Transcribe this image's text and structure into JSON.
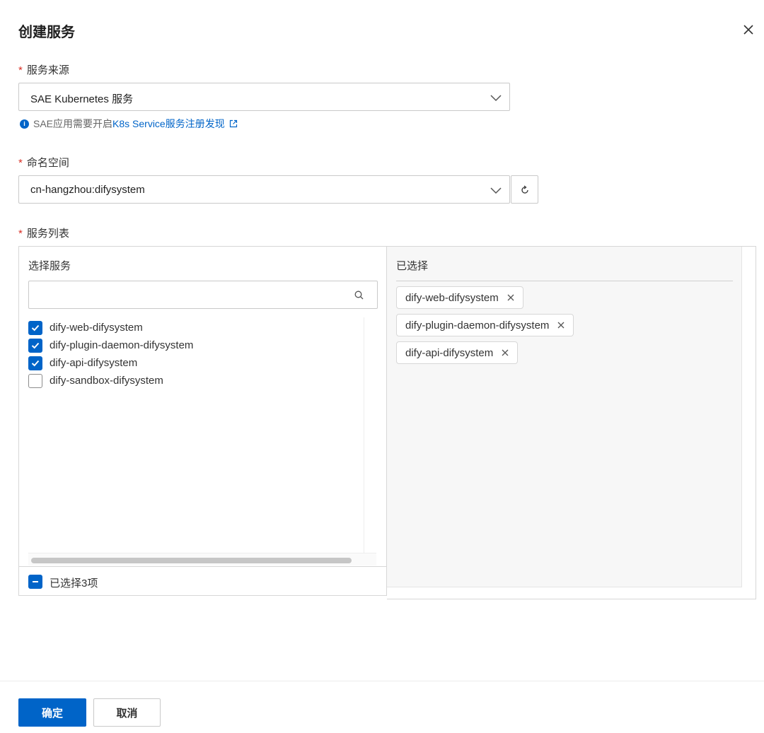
{
  "dialog": {
    "title": "创建服务",
    "close_icon": "close-icon"
  },
  "service_source": {
    "required_mark": "*",
    "label": "服务来源",
    "value": "SAE Kubernetes 服务",
    "hint_prefix": "SAE应用需要开启",
    "hint_link": "K8s Service服务注册发现"
  },
  "namespace": {
    "required_mark": "*",
    "label": "命名空间",
    "value": "cn-hangzhou:difysystem"
  },
  "service_list": {
    "required_mark": "*",
    "label": "服务列表",
    "left": {
      "title": "选择服务",
      "search_placeholder": "",
      "items": [
        {
          "label": "dify-web-difysystem",
          "checked": true
        },
        {
          "label": "dify-plugin-daemon-difysystem",
          "checked": true
        },
        {
          "label": "dify-api-difysystem",
          "checked": true
        },
        {
          "label": "dify-sandbox-difysystem",
          "checked": false
        }
      ],
      "footer": "已选择3项"
    },
    "right": {
      "title": "已选择",
      "tags": [
        {
          "label": "dify-web-difysystem"
        },
        {
          "label": "dify-plugin-daemon-difysystem"
        },
        {
          "label": "dify-api-difysystem"
        }
      ]
    }
  },
  "footer": {
    "confirm_label": "确定",
    "cancel_label": "取消"
  },
  "colors": {
    "primary": "#0064c8",
    "required": "#d93026"
  }
}
